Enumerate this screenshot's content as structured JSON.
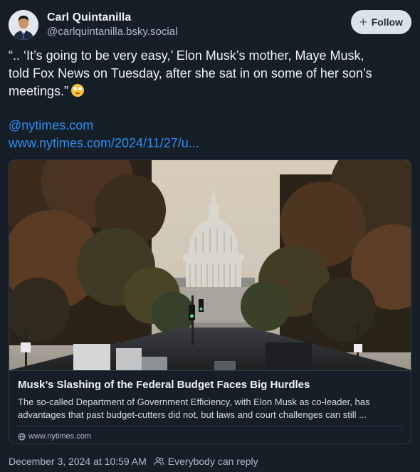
{
  "author": {
    "display_name": "Carl Quintanilla",
    "handle": "@carlquintanilla.bsky.social"
  },
  "follow_button": {
    "label": "Follow",
    "icon": "plus-icon"
  },
  "post": {
    "line1": "“.. ‘It’s going to be very easy,’ Elon Musk’s mother, Maye Musk,",
    "line2": "told Fox News on Tuesday, after she sat in on some of her son’s",
    "line3": "meetings.”",
    "emoji": "face-with-rolling-eyes",
    "mention": "@nytimes.com",
    "link": "www.nytimes.com/2024/11/27/u..."
  },
  "link_card": {
    "title": "Musk’s Slashing of the Federal Budget Faces Big Hurdles",
    "desc_line1": "The so-called Department of Government Efficiency, with Elon Musk as co-leader, has",
    "desc_line2": "advantages that past budget-cutters did not, but laws and court challenges can still ...",
    "source": "www.nytimes.com",
    "image": "capitol-dome-street-photo"
  },
  "footer": {
    "timestamp": "December 3, 2024 at 10:59 AM",
    "reply_setting": "Everybody can reply"
  },
  "colors": {
    "background": "#161e27",
    "link": "#2f8ff2",
    "muted": "#aebbc9",
    "button_bg": "#dce2ea"
  }
}
